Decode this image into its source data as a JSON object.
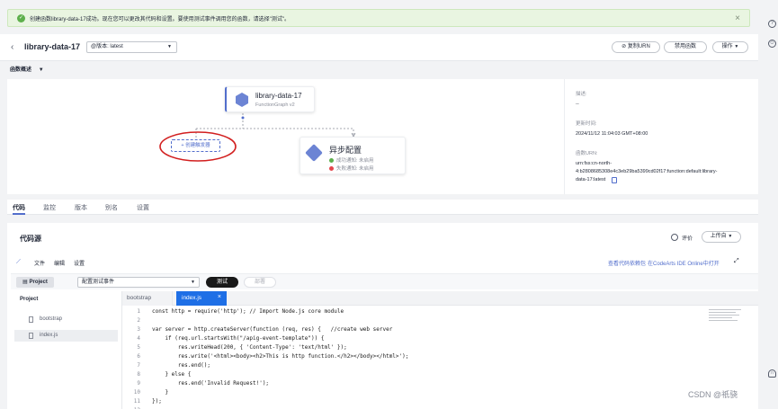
{
  "banner": {
    "message": "创建函数library-data-17成功。现在您可以更改其代码和设置。要使用测试事件调用您的函数，请选择\"测试\"。",
    "close": "×"
  },
  "header": {
    "back": "‹",
    "function_name": "library-data-17",
    "version_select": "@版本: latest",
    "copy_urn": "复制URN",
    "disable_function": "禁用函数",
    "operations": "操作"
  },
  "overview": {
    "label": "函数概述"
  },
  "canvas": {
    "function_node": {
      "title": "library-data-17",
      "subtitle": "FunctionGraph v2"
    },
    "trigger": {
      "label": "+ 创建触发器"
    },
    "async_node": {
      "title": "异步配置",
      "success": "成功通知:  未启用",
      "failure": "失败通知:  未启用"
    }
  },
  "meta": {
    "desc_label": "描述:",
    "desc_value": "--",
    "updated_label": "更新时间:",
    "updated_value": "2024/11/12 11:04:03 GMT+08:00",
    "urn_label": "函数URN:",
    "urn_line1": "urn:fss:cn-north-",
    "urn_line2": "4:b2808685308e4c3eb29ba5399cd02f17:function:default:library-",
    "urn_line3": "data-17:latest"
  },
  "tabs": [
    "代码",
    "监控",
    "版本",
    "别名",
    "设置"
  ],
  "code_source": {
    "title": "代码源",
    "rating": "评价",
    "upload": "上传自",
    "menus": [
      "文件",
      "编辑",
      "设置"
    ],
    "dependency_link": "查看代码依赖包",
    "ide_link": "在CodeArts IDE Online中打开",
    "project_button": "Project",
    "test_event_select": "配置测试事件",
    "test_button": "测试",
    "deploy_button": "部署"
  },
  "project": {
    "title": "Project",
    "files": [
      "bootstrap",
      "index.js"
    ]
  },
  "file_tabs": {
    "tab1": "bootstrap",
    "tab2": "index.js"
  },
  "code_lines": [
    "const http = require('http'); // Import Node.js core module",
    "",
    "var server = http.createServer(function (req, res) {   //create web server",
    "    if (req.url.startsWith(\"/apig-event-template\")) {",
    "        res.writeHead(200, { 'Content-Type': 'text/html' });",
    "        res.write('<html><body><h2>This is http function.</h2></body></html>');",
    "        res.end();",
    "    } else {",
    "        res.end('Invalid Request!');",
    "    }",
    "});",
    ""
  ],
  "line_numbers": [
    "1",
    "2",
    "3",
    "4",
    "5",
    "6",
    "7",
    "8",
    "9",
    "10",
    "11",
    "12"
  ],
  "watermark": "CSDN @祇骁",
  "colors": {
    "accent": "#526ecc",
    "success_bg": "#e9f5e1",
    "highlight_red": "#d21f1f",
    "dark_button": "#191919"
  }
}
